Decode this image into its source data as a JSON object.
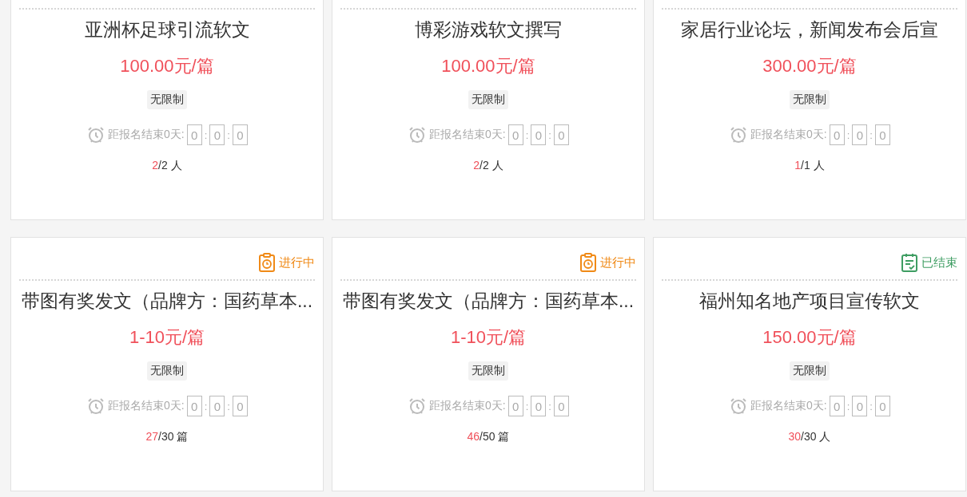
{
  "cards": [
    {
      "title": "亚洲杯足球引流软文",
      "price": "100.00元/篇",
      "limit": "无限制",
      "countdown": {
        "label": "距报名结束0天:",
        "hours": "0",
        "sep1": ":",
        "minutes": "0",
        "sep2": ":",
        "seconds": "0"
      },
      "count": {
        "filled": "2",
        "rest": "/2 人"
      }
    },
    {
      "title": "博彩游戏软文撰写",
      "price": "100.00元/篇",
      "limit": "无限制",
      "countdown": {
        "label": "距报名结束0天:",
        "hours": "0",
        "sep1": ":",
        "minutes": "0",
        "sep2": ":",
        "seconds": "0"
      },
      "count": {
        "filled": "2",
        "rest": "/2 人"
      }
    },
    {
      "title": "家居行业论坛，新闻发布会后宣",
      "price": "300.00元/篇",
      "limit": "无限制",
      "countdown": {
        "label": "距报名结束0天:",
        "hours": "0",
        "sep1": ":",
        "minutes": "0",
        "sep2": ":",
        "seconds": "0"
      },
      "count": {
        "filled": "1",
        "rest": "/1 人"
      }
    },
    {
      "status": {
        "kind": "ongoing",
        "label": "进行中"
      },
      "title": "带图有奖发文（品牌方：国药草本...",
      "price": "1-10元/篇",
      "limit": "无限制",
      "countdown": {
        "label": "距报名结束0天:",
        "hours": "0",
        "sep1": ":",
        "minutes": "0",
        "sep2": ":",
        "seconds": "0"
      },
      "count": {
        "filled": "27",
        "rest": "/30 篇"
      }
    },
    {
      "status": {
        "kind": "ongoing",
        "label": "进行中"
      },
      "title": "带图有奖发文（品牌方：国药草本...",
      "price": "1-10元/篇",
      "limit": "无限制",
      "countdown": {
        "label": "距报名结束0天:",
        "hours": "0",
        "sep1": ":",
        "minutes": "0",
        "sep2": ":",
        "seconds": "0"
      },
      "count": {
        "filled": "46",
        "rest": "/50 篇"
      }
    },
    {
      "status": {
        "kind": "ended",
        "label": "已结束"
      },
      "title": "福州知名地产项目宣传软文",
      "price": "150.00元/篇",
      "limit": "无限制",
      "countdown": {
        "label": "距报名结束0天:",
        "hours": "0",
        "sep1": ":",
        "minutes": "0",
        "sep2": ":",
        "seconds": "0"
      },
      "count": {
        "filled": "30",
        "rest": "/30 人"
      }
    }
  ]
}
